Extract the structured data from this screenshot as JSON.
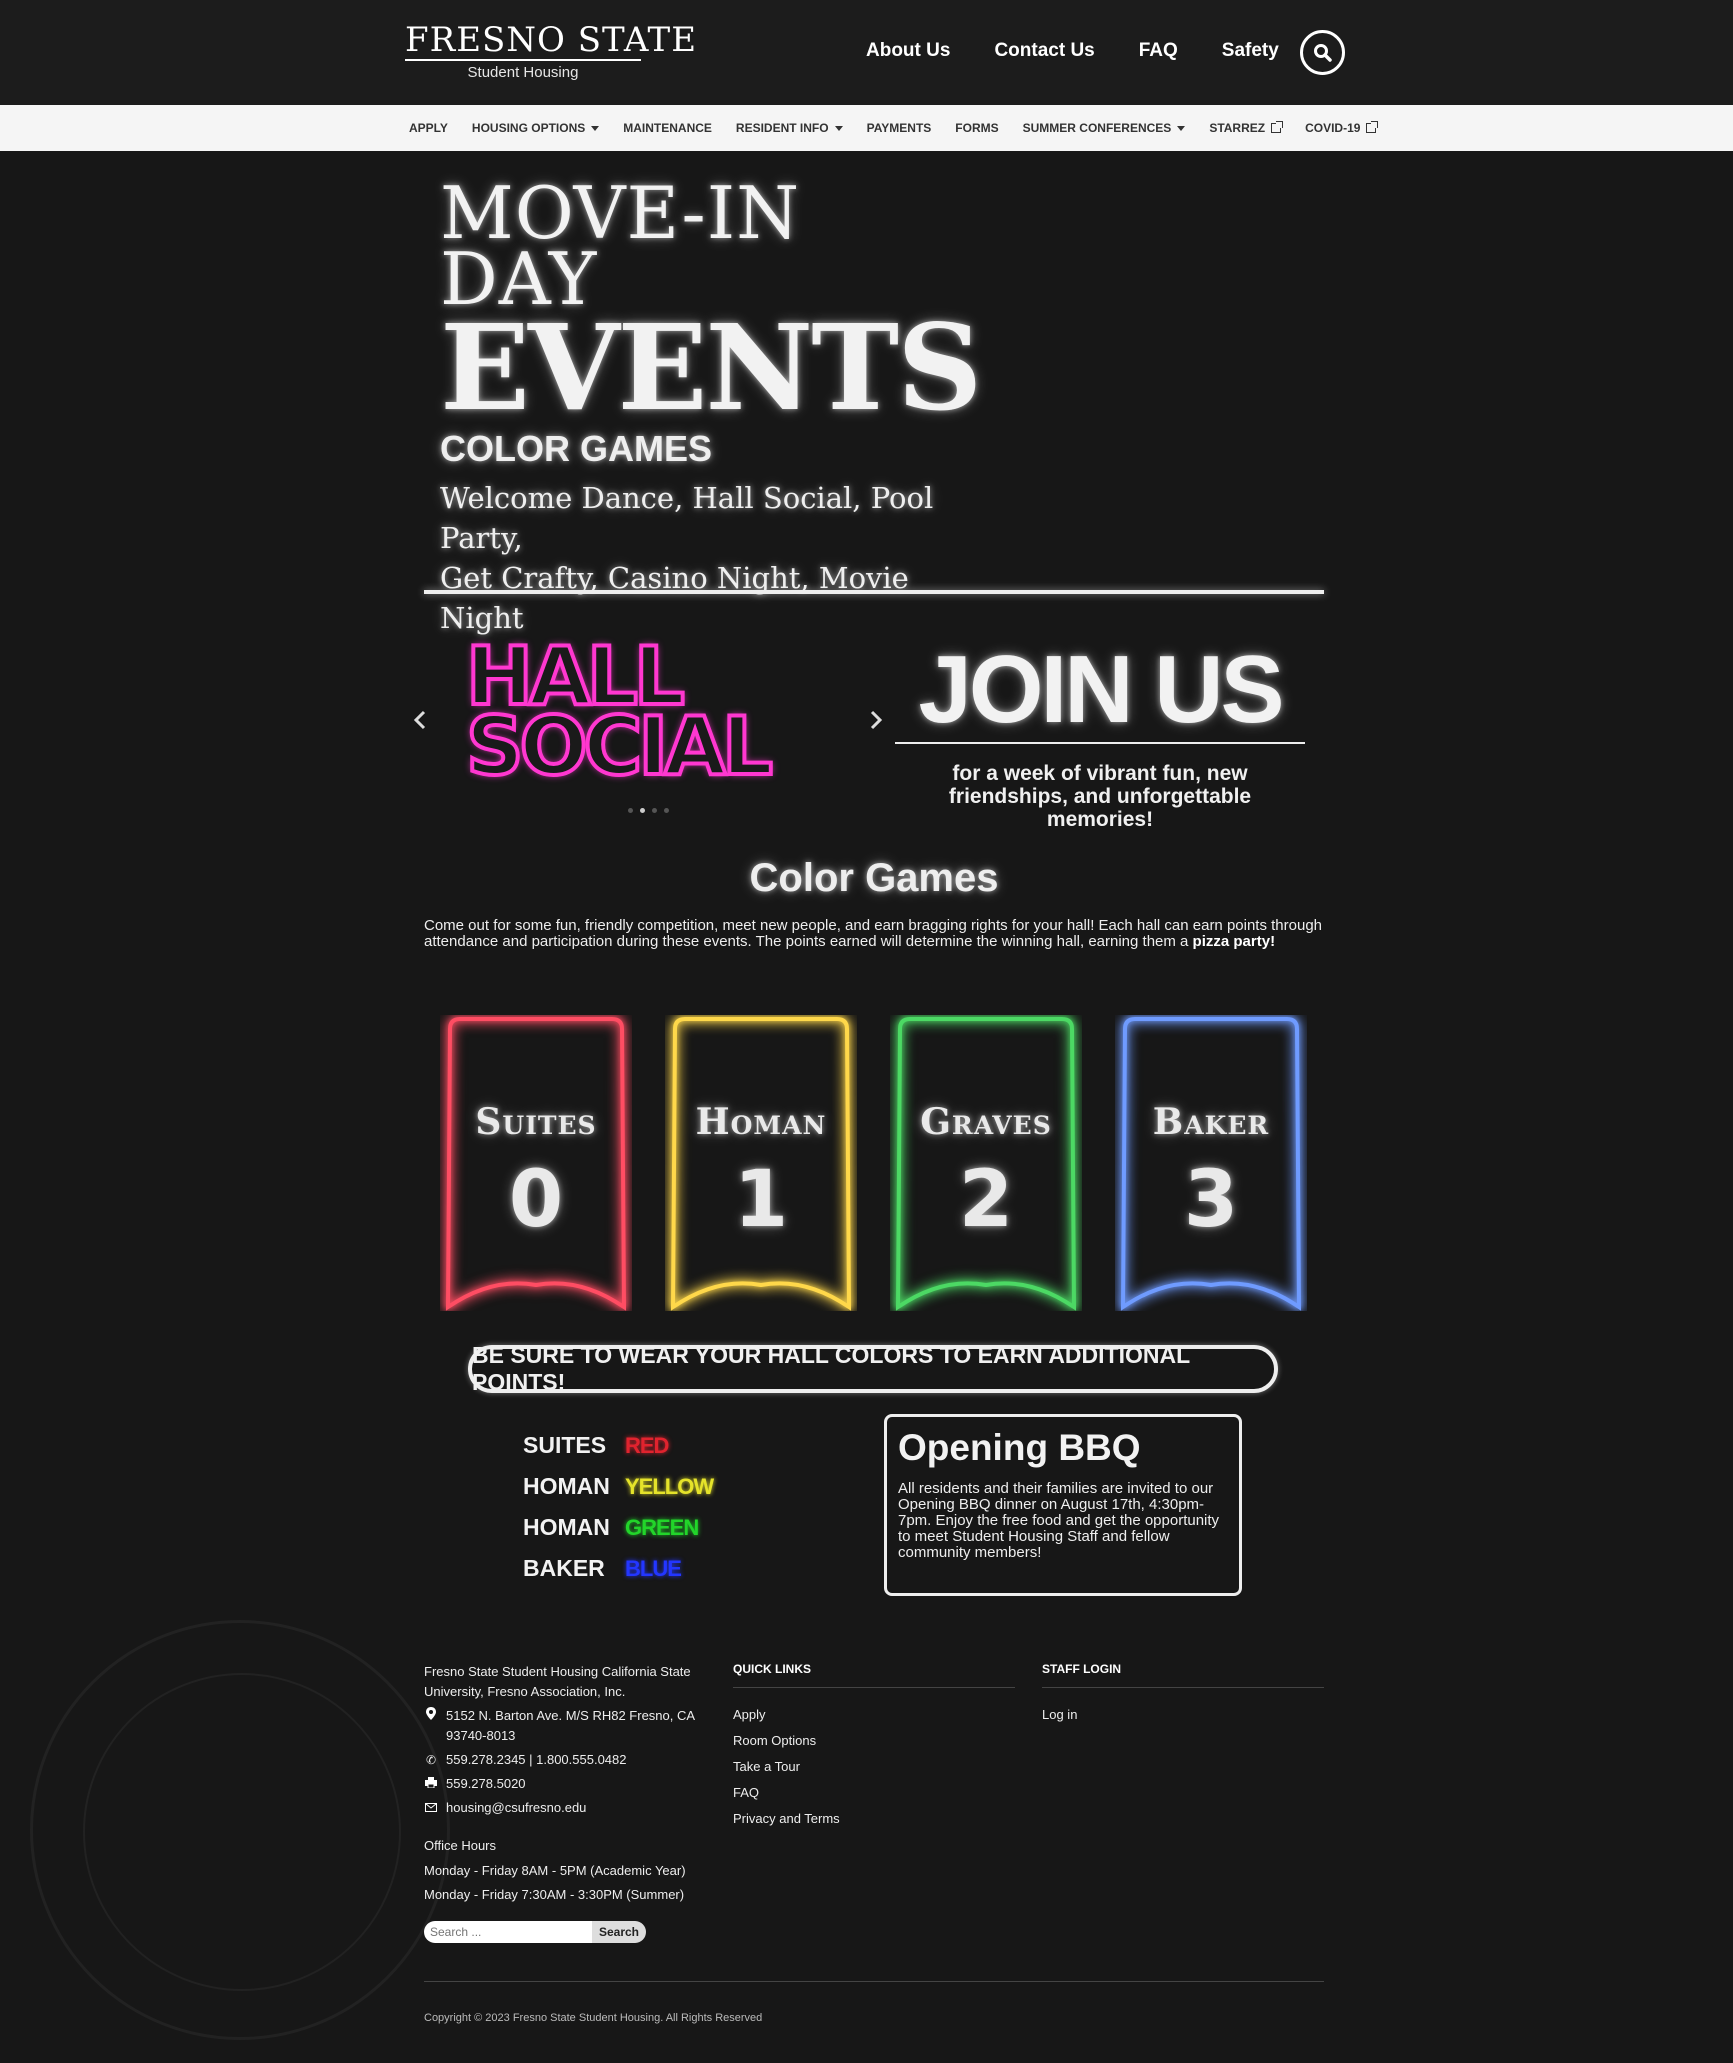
{
  "header": {
    "logo_main": "FRESNO STATE",
    "logo_sub": "Student Housing",
    "nav": [
      "About Us",
      "Contact Us",
      "FAQ",
      "Safety"
    ]
  },
  "subnav": {
    "items": [
      {
        "label": "APPLY",
        "marker": ""
      },
      {
        "label": "HOUSING OPTIONS",
        "marker": "caret"
      },
      {
        "label": "MAINTENANCE",
        "marker": ""
      },
      {
        "label": "RESIDENT INFO",
        "marker": "caret"
      },
      {
        "label": "PAYMENTS",
        "marker": ""
      },
      {
        "label": "FORMS",
        "marker": ""
      },
      {
        "label": "SUMMER CONFERENCES",
        "marker": "caret"
      },
      {
        "label": "STARREZ",
        "marker": "external"
      },
      {
        "label": "COVID-19",
        "marker": "external"
      }
    ]
  },
  "hero": {
    "line1": "MOVE-IN",
    "line2": "DAY",
    "line3": "EVENTS",
    "subtitle": "COLOR GAMES",
    "events_line1": "Welcome Dance, Hall Social, Pool Party,",
    "events_line2": "Get Crafty, Casino Night, Movie Night"
  },
  "carousel": {
    "slide_word1": "HALL",
    "slide_word2": "SOCIAL",
    "slide_color": "#ff37d0",
    "join_title": "JOIN US",
    "join_sub_line1": "for a week of vibrant fun, new",
    "join_sub_line2": "friendships, and unforgettable memories!",
    "dot_count": 4,
    "active_dot": 1
  },
  "color_games": {
    "title": "Color Games",
    "text": "Come out for some fun, friendly competition, meet new people, and earn bragging rights for your hall! Each hall can earn points through attendance and participation during these events. The points earned will determine the winning hall, earning them a ",
    "text_bold": "pizza party!",
    "banners": [
      {
        "name": "Suites",
        "number": "0",
        "color": "#ff4d63"
      },
      {
        "name": "Homan",
        "number": "1",
        "color": "#ffd84a"
      },
      {
        "name": "Graves",
        "number": "2",
        "color": "#4cd964"
      },
      {
        "name": "Baker",
        "number": "3",
        "color": "#6f9bff"
      }
    ],
    "wear_notice": "BE SURE TO WEAR YOUR HALL COLORS TO EARN ADDITIONAL POINTS!",
    "hall_colors": [
      {
        "hall": "SUITES",
        "color_name": "RED",
        "color": "#e0232e"
      },
      {
        "hall": "HOMAN",
        "color_name": "YELLOW",
        "color": "#e5e32a"
      },
      {
        "hall": "HOMAN",
        "color_name": "GREEN",
        "color": "#22d52a"
      },
      {
        "hall": "BAKER",
        "color_name": "BLUE",
        "color": "#2336ff"
      }
    ]
  },
  "bbq": {
    "title": "Opening BBQ",
    "text": "All residents and their families are invited to our Opening BBQ dinner on August 17th, 4:30pm-7pm. Enjoy the free food and get the opportunity to meet Student Housing Staff and fellow community members!"
  },
  "footer": {
    "org": "Fresno State Student Housing California State University, Fresno Association, Inc.",
    "address": "5152 N. Barton Ave. M/S RH82 Fresno, CA 93740-8013",
    "phone": "559.278.2345 | 1.800.555.0482",
    "fax": "559.278.5020",
    "email": "housing@csufresno.edu",
    "hours_title": "Office Hours",
    "hours1": "Monday - Friday 8AM - 5PM (Academic Year)",
    "hours2": "Monday - Friday 7:30AM - 3:30PM (Summer)",
    "search_placeholder": "Search ...",
    "search_button": "Search",
    "quick_links_title": "QUICK LINKS",
    "quick_links": [
      "Apply",
      "Room Options",
      "Take a Tour",
      "FAQ",
      "Privacy and Terms"
    ],
    "staff_title": "STAFF LOGIN",
    "staff_links": [
      "Log in"
    ],
    "copyright": "Copyright © 2023 Fresno State Student Housing. All Rights Reserved"
  }
}
